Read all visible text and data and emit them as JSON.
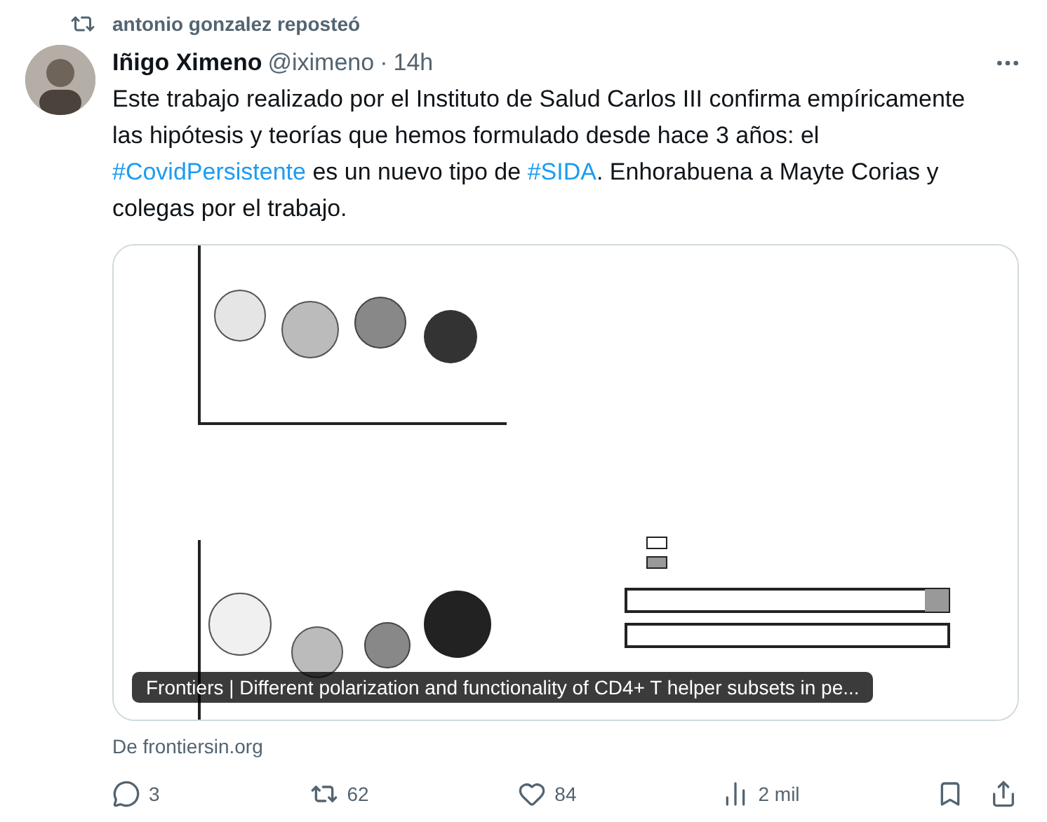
{
  "repost": {
    "label": "antonio gonzalez reposteó"
  },
  "tweet": {
    "name": "Iñigo Ximeno",
    "handle": "@iximeno",
    "dot": "·",
    "time": "14h",
    "text": [
      {
        "kind": "text",
        "value": "Este trabajo realizado por el Instituto de Salud Carlos III confirma empíricamente las hipótesis y teorías que hemos formulado desde hace 3 años: el "
      },
      {
        "kind": "hashtag",
        "value": "#CovidPersistente"
      },
      {
        "kind": "text",
        "value": " es un nuevo tipo de "
      },
      {
        "kind": "hashtag",
        "value": "#SIDA"
      },
      {
        "kind": "text",
        "value": ". Enhorabuena a Mayte Corias y colegas por el trabajo."
      }
    ]
  },
  "card": {
    "kind": "picture",
    "title": "Frontiers | Different polarization and functionality of CD4+ T helper subsets in pe...",
    "source": "De frontiersin.org"
  },
  "actions": [
    {
      "kind": "reply",
      "count": "3"
    },
    {
      "kind": "repost",
      "count": "62"
    },
    {
      "kind": "like",
      "count": "84"
    },
    {
      "kind": "views",
      "count": "2 mil"
    },
    {
      "kind": "bookmark"
    },
    {
      "kind": "share"
    }
  ]
}
